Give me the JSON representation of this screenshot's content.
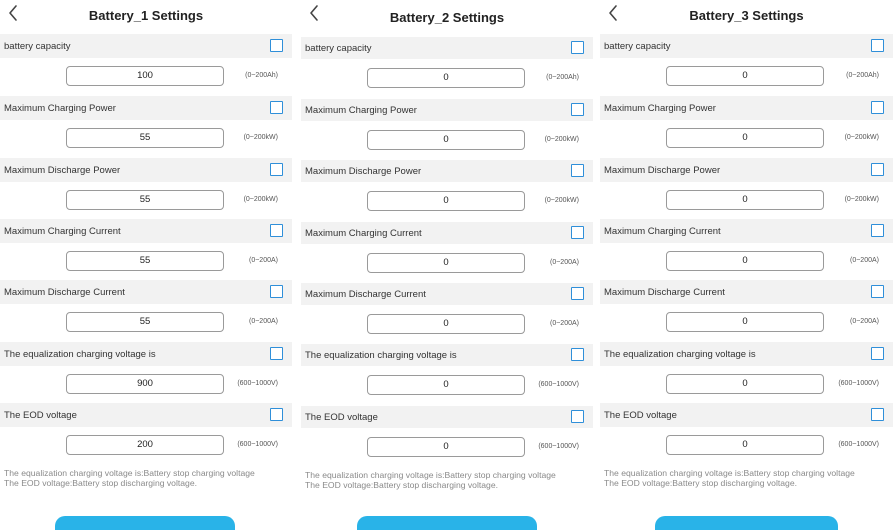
{
  "colors": {
    "accent": "#2f8fd9",
    "row_bg": "#f2f2f2",
    "button": "#29b3e8",
    "note_text": "#8a8a8a"
  },
  "panels": [
    {
      "title": "Battery_1 Settings",
      "fields": [
        {
          "label": "battery capacity",
          "value": "100",
          "range": "(0~200Ah)"
        },
        {
          "label": "Maximum Charging Power",
          "value": "55",
          "range": "(0~200kW)"
        },
        {
          "label": "Maximum Discharge Power",
          "value": "55",
          "range": "(0~200kW)"
        },
        {
          "label": "Maximum Charging Current",
          "value": "55",
          "range": "(0~200A)"
        },
        {
          "label": "Maximum Discharge Current",
          "value": "55",
          "range": "(0~200A)"
        },
        {
          "label": "The equalization charging voltage is",
          "value": "900",
          "range": "(600~1000V)"
        },
        {
          "label": "The EOD voltage",
          "value": "200",
          "range": "(600~1000V)"
        }
      ],
      "notes": [
        "The equalization charging voltage is:Battery stop charging voltage",
        "The EOD voltage:Battery stop discharging voltage."
      ]
    },
    {
      "title": "Battery_2 Settings",
      "fields": [
        {
          "label": "battery capacity",
          "value": "0",
          "range": "(0~200Ah)"
        },
        {
          "label": "Maximum Charging Power",
          "value": "0",
          "range": "(0~200kW)"
        },
        {
          "label": "Maximum Discharge Power",
          "value": "0",
          "range": "(0~200kW)"
        },
        {
          "label": "Maximum Charging Current",
          "value": "0",
          "range": "(0~200A)"
        },
        {
          "label": "Maximum Discharge Current",
          "value": "0",
          "range": "(0~200A)"
        },
        {
          "label": "The equalization charging voltage is",
          "value": "0",
          "range": "(600~1000V)"
        },
        {
          "label": "The EOD voltage",
          "value": "0",
          "range": "(600~1000V)"
        }
      ],
      "notes": [
        "The equalization charging voltage is:Battery stop charging voltage",
        "The EOD voltage:Battery stop discharging voltage."
      ]
    },
    {
      "title": "Battery_3 Settings",
      "fields": [
        {
          "label": "battery capacity",
          "value": "0",
          "range": "(0~200Ah)"
        },
        {
          "label": "Maximum Charging Power",
          "value": "0",
          "range": "(0~200kW)"
        },
        {
          "label": "Maximum Discharge Power",
          "value": "0",
          "range": "(0~200kW)"
        },
        {
          "label": "Maximum Charging Current",
          "value": "0",
          "range": "(0~200A)"
        },
        {
          "label": "Maximum Discharge Current",
          "value": "0",
          "range": "(0~200A)"
        },
        {
          "label": "The equalization charging voltage is",
          "value": "0",
          "range": "(600~1000V)"
        },
        {
          "label": "The EOD voltage",
          "value": "0",
          "range": "(600~1000V)"
        }
      ],
      "notes": [
        "The equalization charging voltage is:Battery stop charging voltage",
        "The EOD voltage:Battery stop discharging voltage."
      ]
    }
  ]
}
